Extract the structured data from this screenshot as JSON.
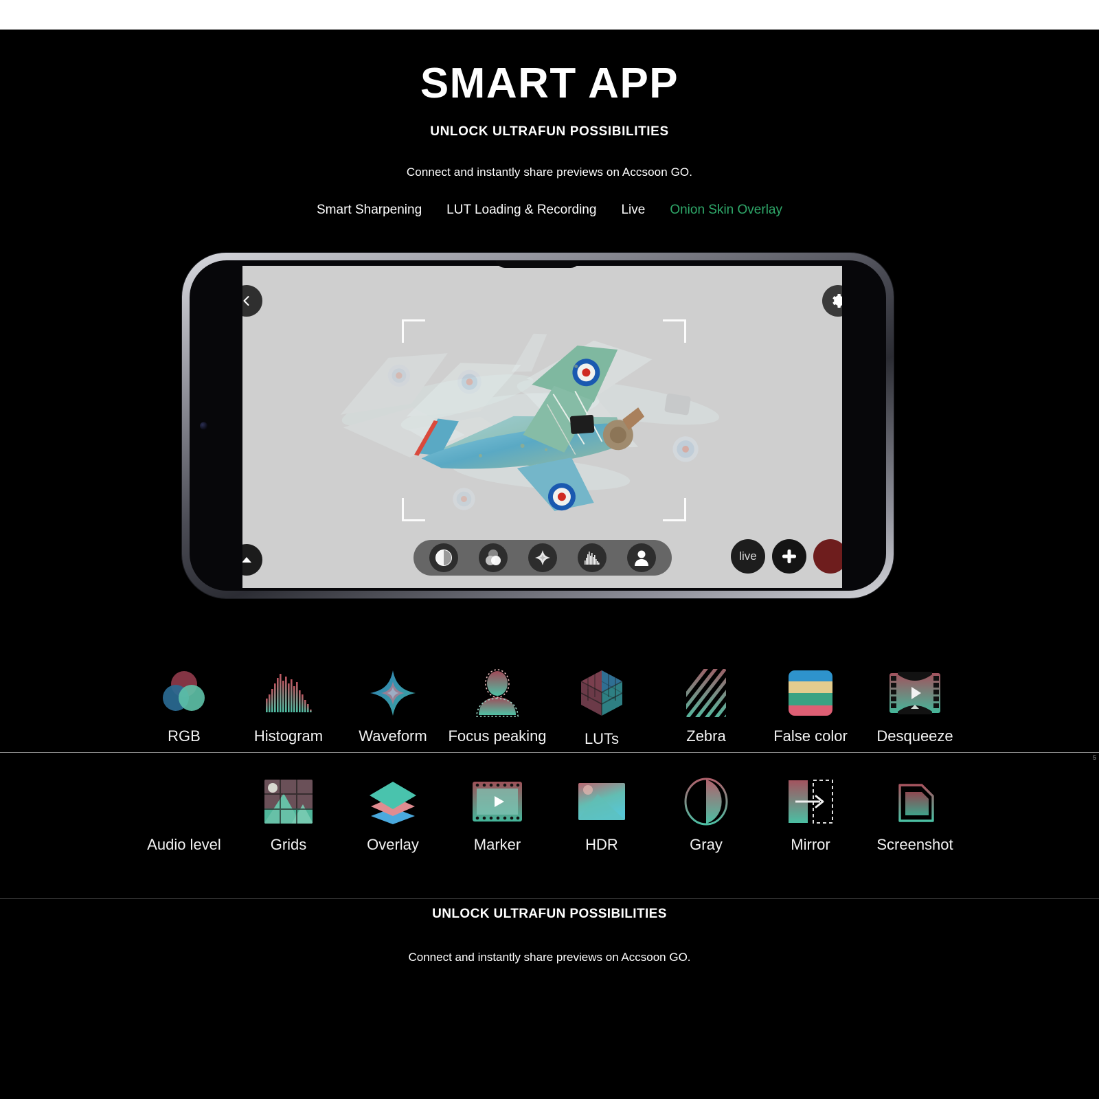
{
  "hero": {
    "title": "SMART APP",
    "subtitle": "UNLOCK ULTRAFUN POSSIBILITIES",
    "description": "Connect and instantly share previews on Accsoon GO.",
    "nav": [
      {
        "label": "Smart Sharpening",
        "active": false
      },
      {
        "label": "LUT Loading & Recording",
        "active": false
      },
      {
        "label": "Live",
        "active": false
      },
      {
        "label": "Onion Skin Overlay",
        "active": true
      }
    ],
    "accent_color": "#2fa96a"
  },
  "phone": {
    "back_button_icon": "chevron-left-icon",
    "settings_button_icon": "gear-icon",
    "collapse_button_icon": "triangle-up-icon",
    "toolbar_icons": [
      "gray-contrast-icon",
      "rgb-circles-icon",
      "waveform-diamond-icon",
      "histogram-icon",
      "focus-peaking-person-icon"
    ],
    "live_label": "live",
    "add_button_icon": "plus-icon",
    "record_button_icon": "record-icon",
    "preview_subject": "onion-skin-overlay-airplane-preview"
  },
  "features": {
    "row1": [
      {
        "label": "RGB",
        "icon": "rgb-circles-icon"
      },
      {
        "label": "Histogram",
        "icon": "histogram-icon"
      },
      {
        "label": "Waveform",
        "icon": "waveform-diamond-icon"
      },
      {
        "label": "Focus peaking",
        "icon": "focus-peaking-person-icon"
      },
      {
        "label": "LUTs",
        "icon": "lut-cube-icon"
      },
      {
        "label": "Zebra",
        "icon": "zebra-stripes-icon"
      },
      {
        "label": "False color",
        "icon": "false-color-bars-icon"
      },
      {
        "label": "Desqueeze",
        "icon": "desqueeze-film-icon"
      }
    ],
    "row2": [
      {
        "label": "Audio level",
        "icon": "audio-level-icon"
      },
      {
        "label": "Grids",
        "icon": "grids-icon"
      },
      {
        "label": "Overlay",
        "icon": "overlay-layers-icon"
      },
      {
        "label": "Marker",
        "icon": "marker-film-icon"
      },
      {
        "label": "HDR",
        "icon": "hdr-image-icon"
      },
      {
        "label": "Gray",
        "icon": "gray-contrast-icon"
      },
      {
        "label": "Mirror",
        "icon": "mirror-icon"
      },
      {
        "label": "Screenshot",
        "icon": "screenshot-icon"
      }
    ]
  },
  "footer": {
    "title": "UNLOCK ULTRAFUN POSSIBILITIES",
    "description": "Connect and instantly share previews on Accsoon GO.",
    "edge_mark": "5"
  }
}
